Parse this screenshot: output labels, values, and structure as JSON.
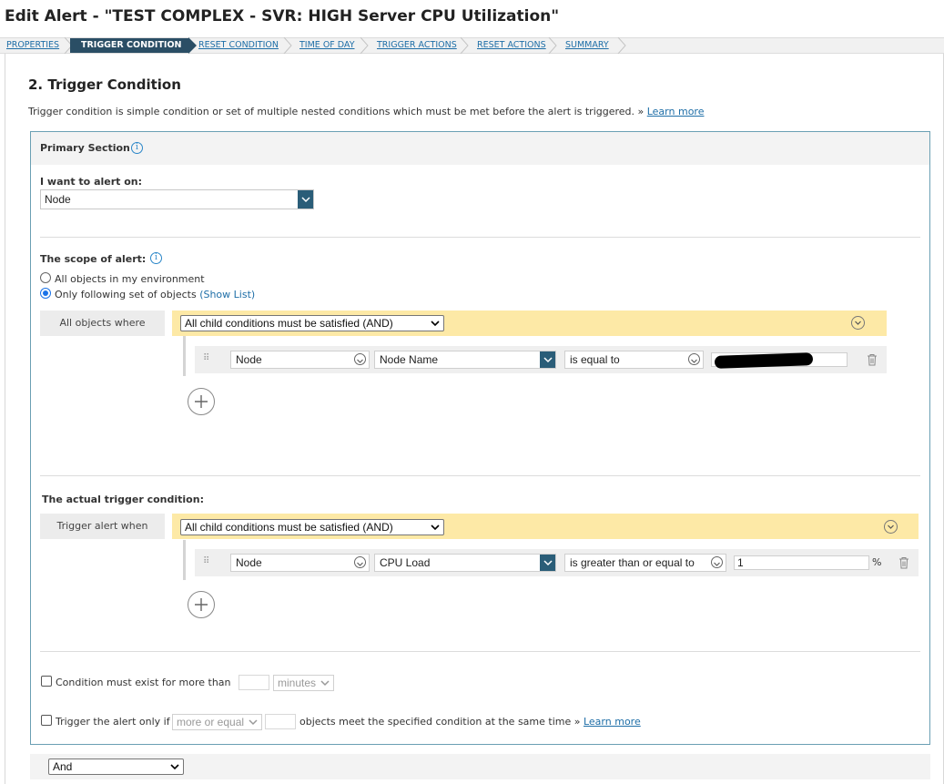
{
  "page": {
    "title": "Edit Alert - \"TEST COMPLEX - SVR: HIGH Server CPU Utilization\""
  },
  "wizard": {
    "steps": [
      {
        "label": "PROPERTIES",
        "active": false
      },
      {
        "label": "TRIGGER CONDITION",
        "active": true
      },
      {
        "label": "RESET CONDITION",
        "active": false
      },
      {
        "label": "TIME OF DAY",
        "active": false
      },
      {
        "label": "TRIGGER ACTIONS",
        "active": false
      },
      {
        "label": "RESET ACTIONS",
        "active": false
      },
      {
        "label": "SUMMARY",
        "active": false
      }
    ]
  },
  "section": {
    "title": "2. Trigger Condition",
    "description": "Trigger condition is simple condition or set of multiple nested conditions which must be met before the alert is triggered. »",
    "learn_more": "Learn more"
  },
  "primary": {
    "header": "Primary Section",
    "alert_on_label": "I want to alert on:",
    "alert_on_value": "Node",
    "scope_label": "The scope of alert:",
    "scope_options": [
      {
        "label": "All objects in my environment",
        "checked": false
      },
      {
        "label": "Only following set of objects",
        "checked": true
      }
    ],
    "show_list": "(Show List)",
    "scope_group": {
      "label": "All objects where",
      "operator": "All child conditions must be satisfied (AND)",
      "condition": {
        "object": "Node",
        "field": "Node Name",
        "comparator": "is equal to",
        "value": ""
      }
    },
    "trigger_label": "The actual trigger condition:",
    "trigger_group": {
      "label": "Trigger alert when",
      "operator": "All child conditions must be satisfied (AND)",
      "condition": {
        "object": "Node",
        "field": "CPU Load",
        "comparator": "is greater than or equal to",
        "value": "1",
        "unit": "%"
      }
    },
    "exist_label": "Condition must exist for more than",
    "exist_unit": "minutes",
    "only_if_prefix": "Trigger the alert only if",
    "only_if_select": "more or equal",
    "only_if_suffix": "objects meet the specified condition at the same time »",
    "only_if_link": "Learn more"
  },
  "bottom": {
    "combiner": "And"
  },
  "colors": {
    "accent": "#2a5d78",
    "active_step": "#2a4e65",
    "link": "#1e6ea7",
    "group_bar": "#fde9a6"
  }
}
